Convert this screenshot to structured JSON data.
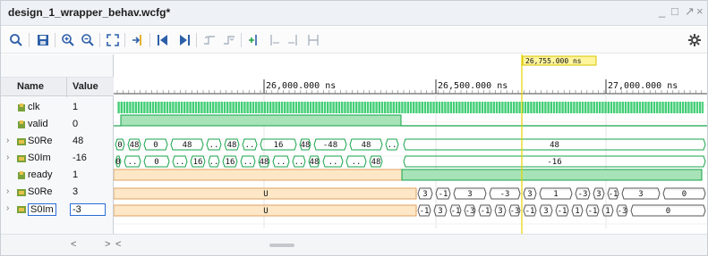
{
  "window": {
    "title": "design_1_wrapper_behav.wcfg*",
    "controls": [
      "_",
      "□",
      "↗",
      "×"
    ]
  },
  "toolbar": {
    "icons": [
      "search-icon",
      "save-icon",
      "zoom-in-icon",
      "zoom-out-icon",
      "zoom-fit-icon",
      "go-to-cursor-icon",
      "go-to-start-icon",
      "go-to-end-icon",
      "prev-transition-icon",
      "next-transition-icon",
      "add-marker-icon",
      "prev-marker-icon",
      "next-marker-icon",
      "swap-cursors-icon",
      "gear-icon"
    ]
  },
  "columns": {
    "name": "Name",
    "value": "Value"
  },
  "signals": [
    {
      "name": "clk",
      "value": "1",
      "kind": "bit",
      "expandable": false
    },
    {
      "name": "valid",
      "value": "0",
      "kind": "bit",
      "expandable": false
    },
    {
      "name": "S0Re",
      "value": "48",
      "kind": "bus",
      "expandable": true
    },
    {
      "name": "S0Im",
      "value": "-16",
      "kind": "bus",
      "expandable": true
    },
    {
      "name": "ready",
      "value": "1",
      "kind": "bit",
      "expandable": false
    },
    {
      "name": "S0Re",
      "value": "3",
      "kind": "bus",
      "expandable": true
    },
    {
      "name": "S0Im",
      "value": "-3",
      "kind": "bus",
      "expandable": true,
      "selected": true
    }
  ],
  "timeline": {
    "labels": [
      "26,000.000 ns",
      "26,500.000 ns",
      "27,000.000 ns"
    ],
    "cursor_label": "26,755.000 ns"
  },
  "waves": {
    "s0re_1": [
      "0",
      "48",
      "0",
      "48",
      "..",
      "48",
      "..",
      "16",
      "48",
      "-48",
      "48",
      "..",
      "48"
    ],
    "s0im_1": [
      "0",
      "..",
      "0",
      "..",
      "16",
      "..",
      "16",
      "..",
      "48",
      "..",
      "..",
      "48",
      "..",
      "..",
      "48",
      "-16"
    ],
    "s0re_2": [
      "U",
      "3",
      "-1",
      "3",
      "-3",
      "3",
      "1",
      "-3",
      "3",
      "-1",
      "3",
      "0"
    ],
    "s0im_2": [
      "U",
      "-1",
      "3",
      "-1",
      "-3",
      "-1",
      "3",
      "-3",
      "-1",
      "3",
      "-1",
      "1",
      "-1",
      "1",
      "-3",
      "0"
    ]
  },
  "colors": {
    "accent": "#2a6cd6",
    "wave_green": "#22c55e",
    "undefined_orange": "#e0a060",
    "cursor": "#e5d400"
  }
}
